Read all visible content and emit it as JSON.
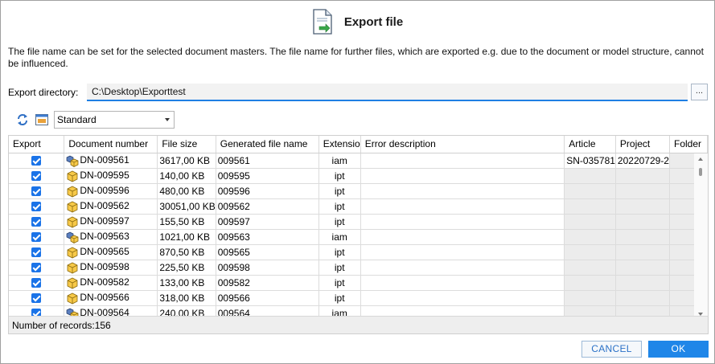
{
  "dialog": {
    "title": "Export file",
    "title_icon": "file-export-icon",
    "description": "The file name can be set for the selected document masters. The file name for further files, which are exported e.g. due to the document or model structure, cannot be influenced."
  },
  "export_dir": {
    "label": "Export directory:",
    "value": "C:\\Desktop\\Exporttest",
    "browse_label": "..."
  },
  "toolbar": {
    "refresh_icon": "refresh-arrows-icon",
    "view_icon": "view-settings-icon",
    "view_selected": "Standard"
  },
  "columns": [
    "Export",
    "Document number",
    "File size",
    "Generated file name",
    "Extensio",
    "Error description",
    "Article",
    "Project",
    "Folder"
  ],
  "rows": [
    {
      "checked": true,
      "type": "assembly",
      "doc": "DN-009561",
      "size": "3617,00 KB",
      "gen": "009561",
      "ext": "iam",
      "err": "",
      "article": "SN-035781",
      "project": "20220729-2",
      "folder": ""
    },
    {
      "checked": true,
      "type": "part",
      "doc": "DN-009595",
      "size": "140,00 KB",
      "gen": "009595",
      "ext": "ipt",
      "err": "",
      "article": "",
      "project": "",
      "folder": ""
    },
    {
      "checked": true,
      "type": "part",
      "doc": "DN-009596",
      "size": "480,00 KB",
      "gen": "009596",
      "ext": "ipt",
      "err": "",
      "article": "",
      "project": "",
      "folder": ""
    },
    {
      "checked": true,
      "type": "part",
      "doc": "DN-009562",
      "size": "30051,00 KB",
      "gen": "009562",
      "ext": "ipt",
      "err": "",
      "article": "",
      "project": "",
      "folder": ""
    },
    {
      "checked": true,
      "type": "part",
      "doc": "DN-009597",
      "size": "155,50 KB",
      "gen": "009597",
      "ext": "ipt",
      "err": "",
      "article": "",
      "project": "",
      "folder": ""
    },
    {
      "checked": true,
      "type": "assembly",
      "doc": "DN-009563",
      "size": "1021,00 KB",
      "gen": "009563",
      "ext": "iam",
      "err": "",
      "article": "",
      "project": "",
      "folder": ""
    },
    {
      "checked": true,
      "type": "part",
      "doc": "DN-009565",
      "size": "870,50 KB",
      "gen": "009565",
      "ext": "ipt",
      "err": "",
      "article": "",
      "project": "",
      "folder": ""
    },
    {
      "checked": true,
      "type": "part",
      "doc": "DN-009598",
      "size": "225,50 KB",
      "gen": "009598",
      "ext": "ipt",
      "err": "",
      "article": "",
      "project": "",
      "folder": ""
    },
    {
      "checked": true,
      "type": "part",
      "doc": "DN-009582",
      "size": "133,00 KB",
      "gen": "009582",
      "ext": "ipt",
      "err": "",
      "article": "",
      "project": "",
      "folder": ""
    },
    {
      "checked": true,
      "type": "part",
      "doc": "DN-009566",
      "size": "318,00 KB",
      "gen": "009566",
      "ext": "ipt",
      "err": "",
      "article": "",
      "project": "",
      "folder": ""
    },
    {
      "checked": true,
      "type": "assembly",
      "doc": "DN-009564",
      "size": "240,00 KB",
      "gen": "009564",
      "ext": "iam",
      "err": "",
      "article": "",
      "project": "",
      "folder": ""
    }
  ],
  "status": {
    "records_label": "Number of records:",
    "records_count": "156"
  },
  "buttons": {
    "cancel": "CANCEL",
    "ok": "OK"
  }
}
